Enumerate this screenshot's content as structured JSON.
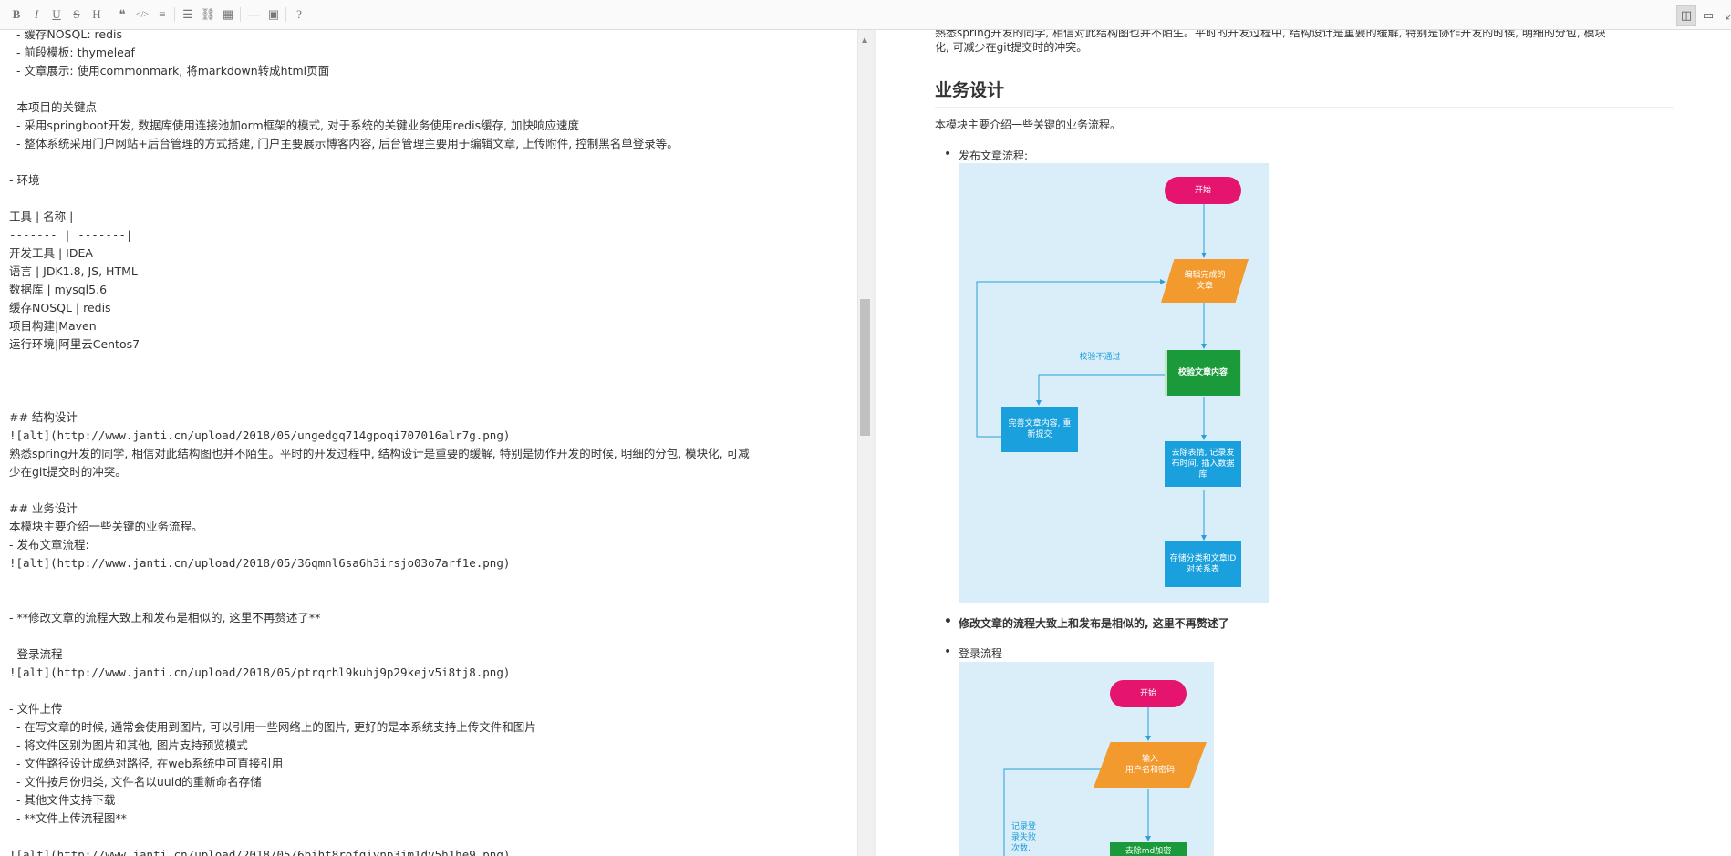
{
  "toolbar": {
    "left_icons": [
      {
        "glyph": "B",
        "name": "bold"
      },
      {
        "glyph": "I",
        "name": "italic"
      },
      {
        "glyph": "U",
        "name": "underline"
      },
      {
        "glyph": "S",
        "name": "strikethrough"
      },
      {
        "glyph": "H",
        "name": "heading"
      },
      {
        "glyph": "❝",
        "name": "quote"
      },
      {
        "glyph": "</>",
        "name": "code"
      },
      {
        "glyph": "≡",
        "name": "ordered-list"
      },
      {
        "glyph": "☰",
        "name": "unordered-list"
      },
      {
        "glyph": "⛓",
        "name": "link"
      },
      {
        "glyph": "▦",
        "name": "table"
      },
      {
        "glyph": "—",
        "name": "horizontal-rule"
      },
      {
        "glyph": "▣",
        "name": "image"
      },
      {
        "glyph": "?",
        "name": "help"
      }
    ],
    "right_icons": [
      {
        "glyph": "◫",
        "name": "side-by-side"
      },
      {
        "glyph": "▭",
        "name": "preview"
      },
      {
        "glyph": "⤢",
        "name": "fullscreen"
      }
    ]
  },
  "editor": {
    "lines": [
      "  - 缓存NOSQL: redis",
      "  - 前段模板: thymeleaf",
      "  - 文章展示: 使用commonmark, 将markdown转成html页面",
      "",
      "- 本项目的关键点",
      "  - 采用springboot开发, 数据库使用连接池加orm框架的模式, 对于系统的关键业务使用redis缓存, 加快响应速度",
      "  - 整体系统采用门户网站+后台管理的方式搭建, 门户主要展示博客内容, 后台管理主要用于编辑文章, 上传附件, 控制黑名单登录等。",
      "",
      "- 环境",
      "",
      "工具 | 名称 |",
      "------- | -------|",
      "开发工具 | IDEA",
      "语言 | JDK1.8, JS, HTML",
      "数据库 | mysql5.6",
      "缓存NOSQL | redis",
      "项目构建|Maven",
      "运行环境|阿里云Centos7",
      "",
      "",
      "",
      "## 结构设计",
      "![alt](http://www.janti.cn/upload/2018/05/ungedgq714gpoqi707016alr7g.png)",
      "熟悉spring开发的同学, 相信对此结构图也并不陌生。平时的开发过程中, 结构设计是重要的缓解, 特别是协作开发的时候, 明细的分包, 模块化, 可减",
      "少在git提交时的冲突。",
      "",
      "## 业务设计",
      "本模块主要介绍一些关键的业务流程。",
      "- 发布文章流程:",
      "![alt](http://www.janti.cn/upload/2018/05/36qmnl6sa6h3irsjo03o7arf1e.png)",
      "",
      "",
      "- **修改文章的流程大致上和发布是相似的, 这里不再赘述了**",
      "",
      "- 登录流程",
      "![alt](http://www.janti.cn/upload/2018/05/ptrqrhl9kuhj9p29kejv5i8tj8.png)",
      "",
      "- 文件上传",
      "  - 在写文章的时候, 通常会使用到图片, 可以引用一些网络上的图片, 更好的是本系统支持上传文件和图片",
      "  - 将文件区别为图片和其他, 图片支持预览模式",
      "  - 文件路径设计成绝对路径, 在web系统中可直接引用",
      "  - 文件按月份归类, 文件名以uuid的重新命名存储",
      "  - 其他文件支持下载",
      "  - **文件上传流程图**",
      "",
      "![alt](http://www.janti.cn/upload/2018/05/6biht8rofqivnp3jm1dv5h1he9.png)",
      ""
    ]
  },
  "preview": {
    "top_para_1": "熟悉spring开发的同学, 相信对此结构图也并不陌生。平时的开发过程中, 结构设计是重要的缓解, 特别是协作开发的时候, 明细的分包, 模块",
    "top_para_2": "化, 可减少在git提交时的冲突。",
    "heading": "业务设计",
    "intro": "本模块主要介绍一些关键的业务流程。",
    "bullet_publish": "发布文章流程:",
    "bullet_modify": "修改文章的流程大致上和发布是相似的, 这里不再赘述了",
    "bullet_login": "登录流程",
    "flow1": {
      "start": "开始",
      "edit": "编辑完成的\n文章",
      "verify": "校验文章内容",
      "fail": "校验不通过",
      "fix": "完善文章内容, 重\n新提交",
      "clean": "去除表情, 记录发\n布时间, 插入数据\n库",
      "store": "存储分类和文章ID\n对关系表"
    },
    "flow2": {
      "start": "开始",
      "input": "输入\n用户名和密码",
      "record": "记录登\n录失败\n次数,",
      "next": "去除md加密"
    },
    "colors": {
      "pink": "#e5156f",
      "orange": "#f39a2e",
      "green": "#1a9a3a",
      "blue": "#1aa0dc",
      "flow_bg": "#d9eef9",
      "line": "#2a9fd8"
    }
  }
}
